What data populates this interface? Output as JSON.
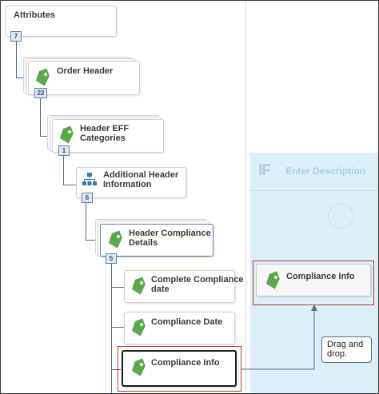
{
  "tree": {
    "attributes_label": "Attributes",
    "attributes_count": "7",
    "order_header_label": "Order Header",
    "order_header_count": "22",
    "header_eff_label_1": "Header EFF",
    "header_eff_label_2": "Categories",
    "header_eff_count": "1",
    "additional_label_1": "Additional Header",
    "additional_label_2": "Information",
    "additional_count": "6",
    "compliance_details_label_1": "Header Compliance",
    "compliance_details_label_2": "Details",
    "compliance_details_count": "5",
    "complete_compliance_label_1": "Complete Compliance",
    "complete_compliance_label_2": "date",
    "compliance_date_label": "Compliance Date",
    "compliance_info_label": "Compliance Info"
  },
  "if_panel": {
    "logo": "IF",
    "description": "Enter Description",
    "dropped_label": "Compliance Info"
  },
  "callout": {
    "line1": "Drag and",
    "line2": "drop."
  },
  "colors": {
    "tag_green": "#5aa84a",
    "panel_blue": "#dceff8",
    "highlight_red": "#c0392b",
    "selected_border": "#6a7fb0"
  }
}
